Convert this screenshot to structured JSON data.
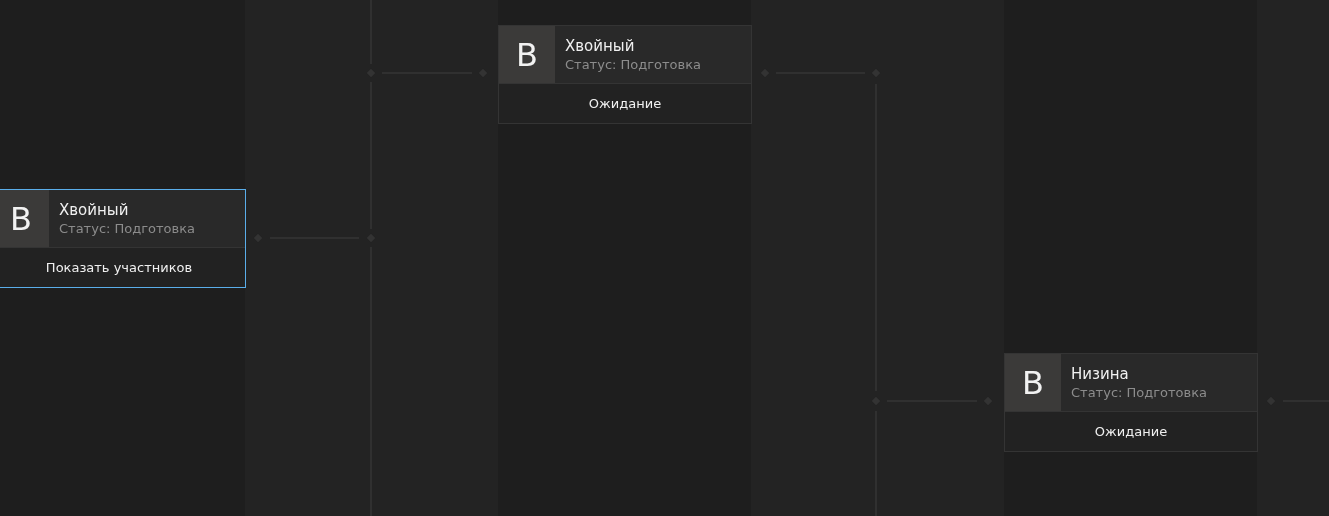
{
  "matches": [
    {
      "avatar": "B",
      "name": "Хвойный",
      "status": "Статус: Подготовка",
      "footer": "Показать участников",
      "selected": true
    },
    {
      "avatar": "B",
      "name": "Хвойный",
      "status": "Статус: Подготовка",
      "footer": "Ожидание",
      "selected": false
    },
    {
      "avatar": "B",
      "name": "Низина",
      "status": "Статус: Подготовка",
      "footer": "Ожидание",
      "selected": false
    }
  ]
}
